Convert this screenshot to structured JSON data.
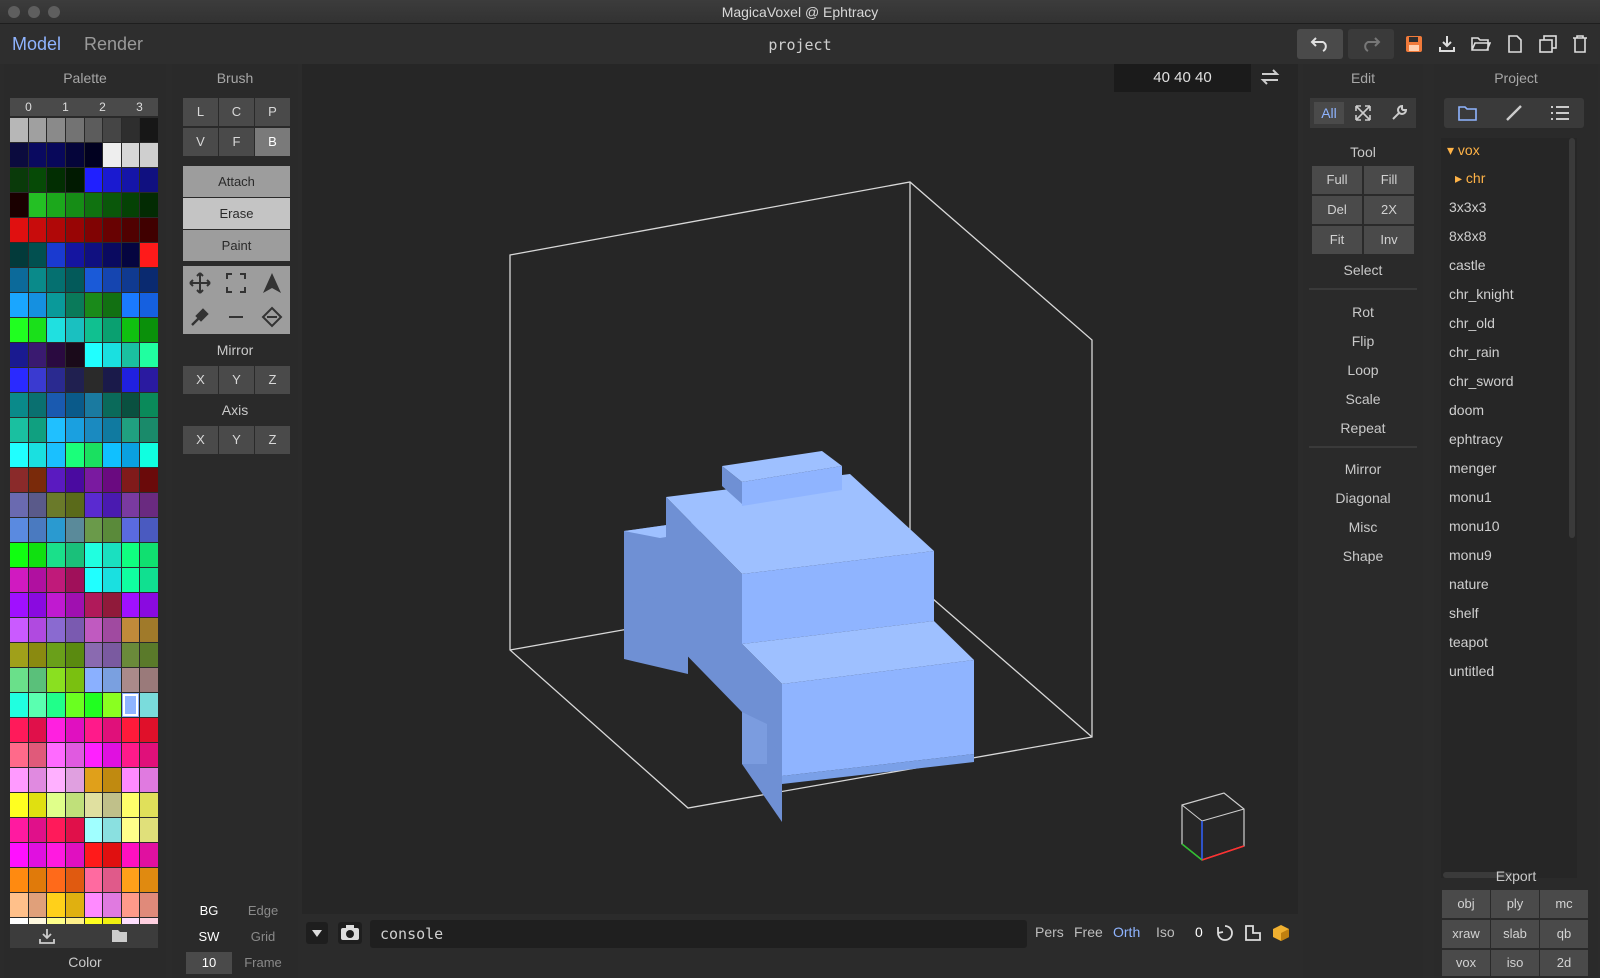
{
  "window": {
    "title": "MagicaVoxel @ Ephtracy"
  },
  "modes": {
    "model": "Model",
    "render": "Render"
  },
  "project_name": "project",
  "toolbar_icons": [
    "undo-icon",
    "redo-icon",
    "save-icon",
    "export-icon",
    "open-icon",
    "new-icon",
    "copy-icon",
    "delete-icon"
  ],
  "palette": {
    "title": "Palette",
    "tabs": [
      "0",
      "1",
      "2",
      "3"
    ],
    "footer": "Color",
    "colors": [
      "#b7b7b7",
      "#a0a0a0",
      "#8a8a8a",
      "#737373",
      "#5c5c5c",
      "#454545",
      "#2e2e2e",
      "#171717",
      "#0b0b3e",
      "#0a0a60",
      "#08085a",
      "#05053a",
      "#010120",
      "#eeeeee",
      "#d7d7d7",
      "#cfcfcf",
      "#0a3a0a",
      "#064a06",
      "#022e02",
      "#011a01",
      "#2020ff",
      "#1a1ad0",
      "#1515a8",
      "#101080",
      "#1a0000",
      "#24c024",
      "#1ca81c",
      "#168d16",
      "#107210",
      "#0a570a",
      "#054205",
      "#032b03",
      "#e01010",
      "#c80c0c",
      "#b00808",
      "#980505",
      "#800303",
      "#680202",
      "#500101",
      "#400000",
      "#033a3a",
      "#025050",
      "#1a3ad0",
      "#1515a0",
      "#101080",
      "#0a0a60",
      "#050540",
      "#ff1a1a",
      "#0c6a9a",
      "#0a8a8a",
      "#057070",
      "#035a5a",
      "#1a5ad8",
      "#1545b0",
      "#103a90",
      "#0a2a70",
      "#1aa6ff",
      "#1590e0",
      "#0a9a9a",
      "#0a7a5a",
      "#1a8a1a",
      "#127012",
      "#1a7aff",
      "#1560e0",
      "#20ff20",
      "#1ae01a",
      "#20e0e0",
      "#1ac0c0",
      "#10c090",
      "#0aa070",
      "#10c010",
      "#0a900a",
      "#1a1a90",
      "#3a1a70",
      "#2a0a40",
      "#1a0a1a",
      "#20ffff",
      "#1ae0e0",
      "#1ac0a0",
      "#20ffa0",
      "#2a2aff",
      "#3a3ad0",
      "#2a2a90",
      "#202050",
      "#2a2a2a",
      "#1a1a4a",
      "#2020e0",
      "#2a1aa0",
      "#0a8a8a",
      "#0a7070",
      "#1a5ab0",
      "#0a5a8a",
      "#1a7aa0",
      "#0a6a5a",
      "#0a5040",
      "#0a8a5a",
      "#1ac0a0",
      "#10a080",
      "#20c0ff",
      "#1aa0e0",
      "#1a8ac0",
      "#107aa0",
      "#20a080",
      "#1a8a6a",
      "#20ffff",
      "#1ae0e0",
      "#1ac0ff",
      "#1aff7a",
      "#1ae060",
      "#10c0ff",
      "#0aa0e0",
      "#10ffe0",
      "#8a2a2a",
      "#7a2a0a",
      "#5a1ac0",
      "#4a0aa0",
      "#7a1aa0",
      "#6a0a80",
      "#801a1a",
      "#6a0a0a",
      "#6a6ab0",
      "#5a5a8a",
      "#6a7a2a",
      "#5a6a1a",
      "#5a2ad0",
      "#4a1ab0",
      "#7a3aa0",
      "#6a2a80",
      "#5a8ae0",
      "#4a7ac0",
      "#2a9ad0",
      "#5a8a9a",
      "#6a9a4a",
      "#5a8a3a",
      "#5a6ae0",
      "#4a5ac0",
      "#10ff10",
      "#10e010",
      "#1ae08a",
      "#1ac07a",
      "#20ffe0",
      "#1ae0c0",
      "#10ff80",
      "#10e070",
      "#d01ac0",
      "#b010a0",
      "#c01a7a",
      "#a0105a",
      "#20ffff",
      "#1ae0e0",
      "#10ffa0",
      "#10e090",
      "#a010ff",
      "#8a0ae0",
      "#c01ad0",
      "#a010b0",
      "#b01a5a",
      "#901a3a",
      "#a010ff",
      "#8a0ae0",
      "#ca5aff",
      "#b04ae0",
      "#8a6ad0",
      "#7a5ab0",
      "#c05ac0",
      "#a04aa0",
      "#c08a3a",
      "#a07a2a",
      "#a0a01a",
      "#8a8a10",
      "#6aa01a",
      "#5a8a10",
      "#8a6ab0",
      "#7a5aa0",
      "#6a8a3a",
      "#5a7a2a",
      "#6ae08a",
      "#5ac07a",
      "#8ae020",
      "#7ac010",
      "#8ab0ff",
      "#7aa0e0",
      "#aa8a8a",
      "#9a7a7a",
      "#20ffe0",
      "#5affb0",
      "#20ff8a",
      "#6aff20",
      "#20ff20",
      "#8aff20",
      "#8fb4ff",
      "#7adcdc",
      "#ff1a5a",
      "#e0104a",
      "#ff20e0",
      "#e010c0",
      "#ff1a8a",
      "#e0107a",
      "#ff1a3a",
      "#e0102a",
      "#ff6a8a",
      "#e05a7a",
      "#ff6aff",
      "#e05ae0",
      "#ff20ff",
      "#e010e0",
      "#ff1a8a",
      "#e0107a",
      "#ff9aff",
      "#e08ae0",
      "#ffb0ff",
      "#e0a0e0",
      "#e0a01a",
      "#c08a10",
      "#ff8aff",
      "#e07ae0",
      "#ffff20",
      "#e0e010",
      "#e0ff8a",
      "#c0e07a",
      "#e0e0a0",
      "#c0c08a",
      "#ffff6a",
      "#e0e05a",
      "#ff1aa0",
      "#e0108a",
      "#ff1a5a",
      "#e0104a",
      "#a0ffff",
      "#8ae0e0",
      "#ffff8a",
      "#e0e07a",
      "#ff10ff",
      "#e010e0",
      "#ff1ae0",
      "#e010c0",
      "#ff1a1a",
      "#e01010",
      "#ff10c0",
      "#e010a0",
      "#ff8a10",
      "#e07a0a",
      "#ff6a1a",
      "#e05a10",
      "#ff6aa0",
      "#e05a8a",
      "#ffa01a",
      "#e08a10",
      "#ffc08a",
      "#e0a07a",
      "#ffd01a",
      "#e0b010",
      "#ff8aff",
      "#e07ae0",
      "#ff9a8a",
      "#e08a7a",
      "#ffffff",
      "#fff8e0",
      "#ffff8a",
      "#fff08a",
      "#ffff20",
      "#f0f010",
      "#ffe0ff",
      "#ffd0e0"
    ],
    "selected_index": 190
  },
  "brush": {
    "title": "Brush",
    "modes_row1": [
      "L",
      "C",
      "P"
    ],
    "modes_row2": [
      "V",
      "F",
      "B"
    ],
    "actions": [
      "Attach",
      "Erase",
      "Paint"
    ],
    "mirror_label": "Mirror",
    "axis_label": "Axis",
    "axes": [
      "X",
      "Y",
      "Z"
    ],
    "tool_icons": [
      "move-icon",
      "select-box-icon",
      "cursor-icon",
      "picker-icon",
      "line-icon",
      "fill-icon"
    ]
  },
  "dims": "40 40 40",
  "edit": {
    "title": "Edit",
    "top_tab": "All",
    "tool_label": "Tool",
    "tool_buttons": [
      [
        "Full",
        "Fill"
      ],
      [
        "Del",
        "2X"
      ],
      [
        "Fit",
        "Inv"
      ]
    ],
    "select_label": "Select",
    "group1": [
      "Rot",
      "Flip",
      "Loop",
      "Scale",
      "Repeat"
    ],
    "group2": [
      "Mirror",
      "Diagonal",
      "Misc",
      "Shape"
    ]
  },
  "project": {
    "title": "Project",
    "root": "vox",
    "folder": "chr",
    "files": [
      "3x3x3",
      "8x8x8",
      "castle",
      "chr_knight",
      "chr_old",
      "chr_rain",
      "chr_sword",
      "doom",
      "ephtracy",
      "menger",
      "monu1",
      "monu10",
      "monu9",
      "nature",
      "shelf",
      "teapot",
      "untitled"
    ],
    "export_label": "Export",
    "export_buttons": [
      [
        "obj",
        "ply",
        "mc"
      ],
      [
        "xraw",
        "slab",
        "qb"
      ],
      [
        "vox",
        "iso",
        "2d"
      ]
    ]
  },
  "bottom": {
    "console_text": "console",
    "views": [
      "Pers",
      "Free",
      "Orth",
      "Iso"
    ],
    "active_view": "Orth",
    "value": "0",
    "bg": "BG",
    "edge": "Edge",
    "sw": "SW",
    "grid": "Grid",
    "frame_value": "10",
    "frame": "Frame"
  },
  "colors": {
    "accent": "#8fb4ff",
    "voxel_front": "#8fb4ff",
    "voxel_top": "#9ec0ff",
    "voxel_side": "#6f90d4",
    "folder": "#ffb347"
  }
}
